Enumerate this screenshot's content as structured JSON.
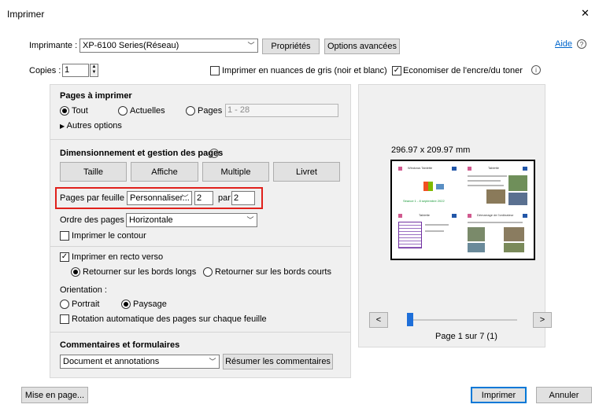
{
  "window": {
    "title": "Imprimer",
    "close_glyph": "✕"
  },
  "printer": {
    "label": "Imprimante :",
    "value": "XP-6100 Series(Réseau)",
    "properties_btn": "Propriétés",
    "advanced_btn": "Options avancées",
    "help_link": "Aide"
  },
  "copies": {
    "label": "Copies :",
    "value": "1"
  },
  "grayscale": {
    "label": "Imprimer en nuances de gris (noir et blanc)",
    "checked": false
  },
  "ink_saver": {
    "label": "Economiser de l'encre/du toner",
    "checked": true
  },
  "pages_to_print": {
    "title": "Pages à imprimer",
    "all": "Tout",
    "current": "Actuelles",
    "pages": "Pages",
    "pages_range_placeholder": "1 - 28",
    "more_options": "Autres options"
  },
  "sizing": {
    "title": "Dimensionnement et gestion des pages",
    "tabs": [
      "Taille",
      "Affiche",
      "Multiple",
      "Livret"
    ],
    "pages_per_sheet_label": "Pages par feuille :",
    "pages_per_sheet_value": "Personnaliser...",
    "cols": "2",
    "by": "par",
    "rows": "2",
    "order_label": "Ordre des pages :",
    "order_value": "Horizontale",
    "print_border": "Imprimer le contour"
  },
  "duplex": {
    "label": "Imprimer en recto verso",
    "long_edge": "Retourner sur les bords longs",
    "short_edge": "Retourner sur les bords courts"
  },
  "orientation": {
    "label": "Orientation :",
    "portrait": "Portrait",
    "landscape": "Paysage",
    "auto_rotate": "Rotation automatique des pages sur chaque feuille"
  },
  "comments": {
    "title": "Commentaires et formulaires",
    "value": "Document et annotations",
    "summarize_btn": "Résumer les commentaires"
  },
  "preview": {
    "dimensions": "296.97 x 209.97 mm",
    "page_label": "Page 1 sur 7 (1)",
    "prev": "<",
    "next": ">",
    "slider_fraction": 0.0,
    "thumb_texts": {
      "t1": "Windows Tablette",
      "t2": "Tablette",
      "t3": "Séance 1 - 8 septembre 2022",
      "t4": "Tablette",
      "t5": "Démarrage de l'ordinateur"
    }
  },
  "footer": {
    "page_setup": "Mise en page...",
    "print": "Imprimer",
    "cancel": "Annuler"
  },
  "colors": {
    "highlight": "#e0201b",
    "link": "#0066cc",
    "slider": "#1e6fd9",
    "green_text": "#1a9a3a"
  }
}
